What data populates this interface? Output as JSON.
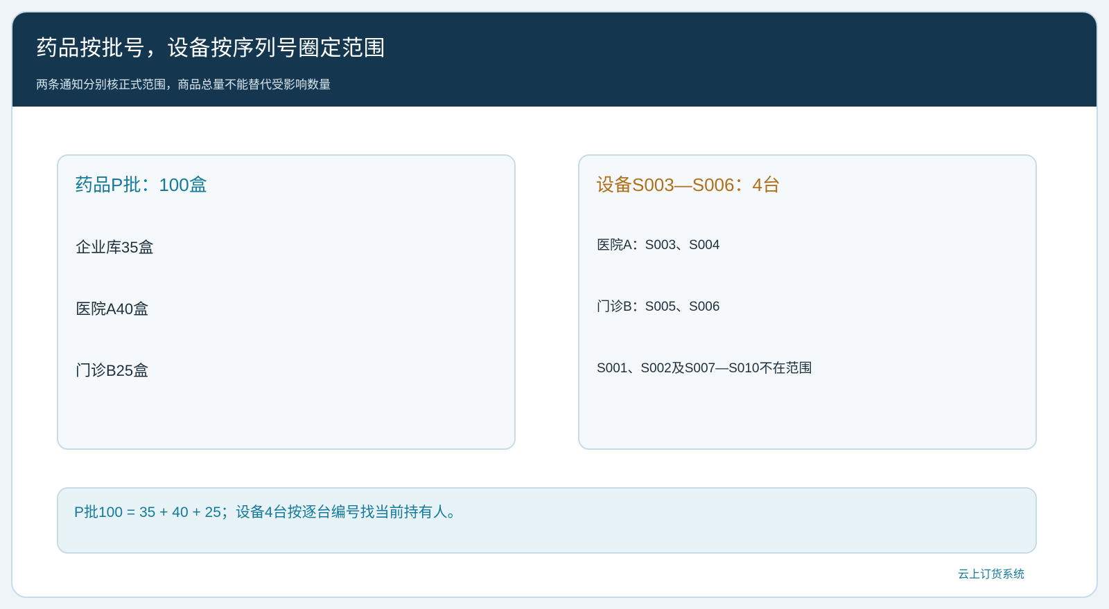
{
  "header": {
    "title": "药品按批号，设备按序列号圈定范围",
    "subtitle": "两条通知分别核正式范围，商品总量不能替代受影响数量"
  },
  "drug_card": {
    "title": "药品P批：100盒",
    "lines": [
      "企业库35盒",
      "医院A40盒",
      "门诊B25盒"
    ]
  },
  "device_card": {
    "title": "设备S003—S006：4台",
    "lines": [
      "医院A：S003、S004",
      "门诊B：S005、S006",
      "S001、S002及S007—S010不在范围"
    ]
  },
  "note": {
    "text": "P批100 = 35 + 40 + 25；设备4台按逐台编号找当前持有人。"
  },
  "footer": {
    "brand": "云上订货系统"
  },
  "colors": {
    "header_bg": "#14364f",
    "accent_blue": "#157a9a",
    "accent_amber": "#b0701a"
  }
}
